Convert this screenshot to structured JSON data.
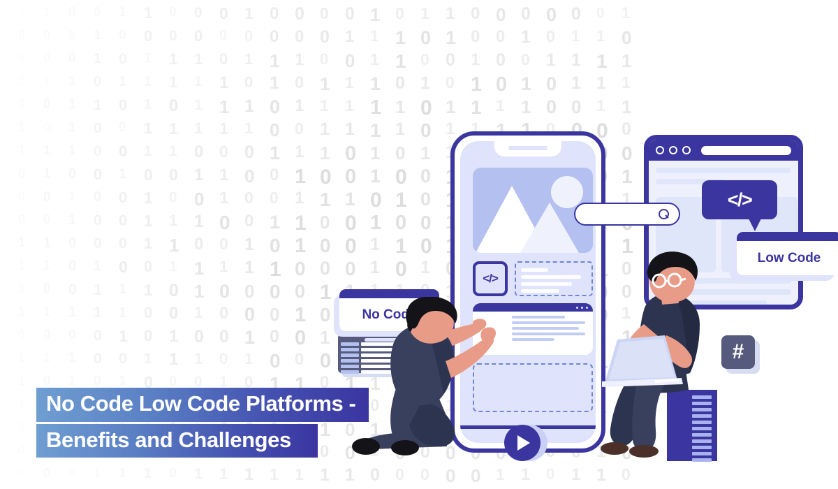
{
  "meta": {
    "background_color": "#ffffff",
    "accent_color": "#3b35a0",
    "light_accent_color": "#dfe3fb",
    "mid_accent_color": "#b4c0f0",
    "slate_color": "#565b7d",
    "skin_color": "#e89b87",
    "hair_color": "#131318",
    "outfit_color": "#38405e"
  },
  "title": {
    "line1": "No Code Low Code Platforms -",
    "line2": "Benefits and Challenges",
    "gradient_from": "#6f9ed2",
    "gradient_to": "#3b35a0",
    "text_color": "#ffffff"
  },
  "cards": {
    "no_code": {
      "label": "No Code",
      "header_color": "#3b35a0",
      "body_color": "#ffffff",
      "text_color": "#3b35a0"
    },
    "low_code": {
      "label": "Low Code",
      "header_color": "#3b35a0",
      "body_color": "#ffffff",
      "text_color": "#3b35a0"
    }
  },
  "bubbles": {
    "code": {
      "glyph": "</>",
      "background": "#3b35a0",
      "text_color": "#ffffff"
    }
  },
  "icons": {
    "hash": {
      "glyph": "#",
      "background": "#565b7d",
      "text_color": "#ffffff"
    },
    "phone_code": {
      "glyph": "</>",
      "color": "#3b35a0"
    },
    "search": {
      "name": "search-icon",
      "color": "#3b35a0"
    },
    "play": {
      "name": "play-icon",
      "color": "#ffffff",
      "background": "#3b35a0"
    },
    "table": {
      "name": "table-list-icon",
      "background": "#565b7d"
    }
  },
  "phone": {
    "screen_color": "#dfe3fb",
    "frame_color": "#3b35a0",
    "image_placeholder_color": "#b4c0f0",
    "card_header_dots": 3,
    "card_text_lines": 5,
    "dashed_text_lines": 4,
    "dropzone_style": "dashed"
  },
  "browser": {
    "titlebar_color": "#3b35a0",
    "dots": 3,
    "body_color": "#eef1fd",
    "content_lines": 7
  },
  "search_bar": {
    "value": "",
    "placeholder": "",
    "border_color": "#3b35a0"
  },
  "server_rack": {
    "slot_count": 11,
    "color": "#3b35a0",
    "slot_color": "#a8b3ee"
  },
  "background_pattern": {
    "type": "binary-digits",
    "glyphs": [
      "0",
      "1"
    ],
    "columns": 26,
    "rows": 21,
    "color": "#e8e8e8",
    "fade_direction": "left-to-right"
  },
  "people": [
    {
      "name": "person-kneeling",
      "pose": "kneeling",
      "outfit_color": "#38405e",
      "hair_color": "#131318",
      "has_glasses": false
    },
    {
      "name": "person-sitting",
      "pose": "sitting-with-laptop",
      "outfit_color": "#2c3450",
      "hair_color": "#131318",
      "has_glasses": true
    }
  ]
}
